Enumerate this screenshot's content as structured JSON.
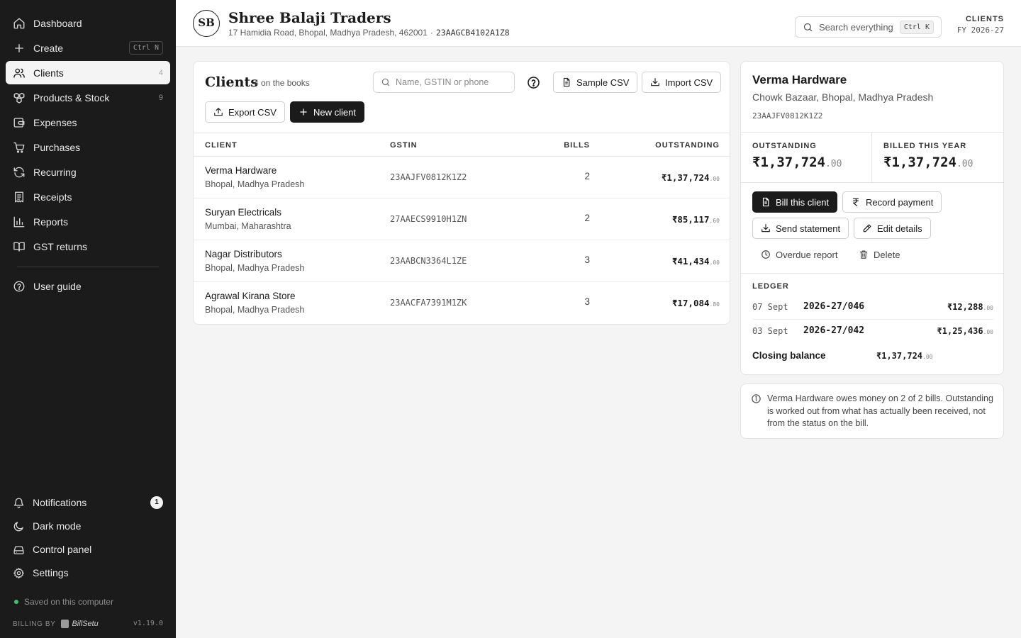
{
  "sidebar": {
    "nav": [
      {
        "label": "Dashboard",
        "icon": "home-icon"
      },
      {
        "label": "Create",
        "icon": "plus-icon",
        "shortcut": "Ctrl N"
      },
      {
        "label": "Clients",
        "icon": "users-icon",
        "count": "4",
        "active": true
      },
      {
        "label": "Products & Stock",
        "icon": "boxes-icon",
        "count": "9"
      },
      {
        "label": "Expenses",
        "icon": "wallet-icon"
      },
      {
        "label": "Purchases",
        "icon": "cart-icon"
      },
      {
        "label": "Recurring",
        "icon": "refresh-icon"
      },
      {
        "label": "Receipts",
        "icon": "receipt-icon"
      },
      {
        "label": "Reports",
        "icon": "bar-chart-icon"
      },
      {
        "label": "GST returns",
        "icon": "book-icon"
      }
    ],
    "user_guide": "User guide",
    "bottom": [
      {
        "label": "Notifications",
        "icon": "bell-icon",
        "badge": "1"
      },
      {
        "label": "Dark mode",
        "icon": "moon-icon"
      },
      {
        "label": "Control panel",
        "icon": "drive-icon"
      },
      {
        "label": "Settings",
        "icon": "gear-icon"
      }
    ],
    "saved_status": "Saved on this computer",
    "billing_by": "BILLING BY",
    "brand": "BillSetu",
    "version": "v1.19.0"
  },
  "header": {
    "avatar_initials": "SB",
    "business_name": "Shree Balaji Traders",
    "address": "17 Hamidia Road, Bhopal, Madhya Pradesh, 462001",
    "separator": "·",
    "gstin": "23AAGCB4102A1Z8",
    "search_placeholder": "Search everything",
    "search_shortcut": "Ctrl K",
    "section": "CLIENTS",
    "fiscal_year": "FY 2026-27"
  },
  "clients": {
    "title": "Clients",
    "count_text": "4 on the books",
    "search_placeholder": "Name, GSTIN or phone",
    "sample_csv": "Sample CSV",
    "import_csv": "Import CSV",
    "export_csv": "Export CSV",
    "new_client": "New client",
    "columns": [
      "CLIENT",
      "GSTIN",
      "BILLS",
      "OUTSTANDING"
    ],
    "rows": [
      {
        "name": "Verma Hardware",
        "location": "Bhopal, Madhya Pradesh",
        "gstin": "23AAJFV0812K1Z2",
        "bills": "2",
        "amount": "₹1,37,724",
        "paise": ".00"
      },
      {
        "name": "Suryan Electricals",
        "location": "Mumbai, Maharashtra",
        "gstin": "27AAECS9910H1ZN",
        "bills": "2",
        "amount": "₹85,117",
        "paise": ".60"
      },
      {
        "name": "Nagar Distributors",
        "location": "Bhopal, Madhya Pradesh",
        "gstin": "23AABCN3364L1ZE",
        "bills": "3",
        "amount": "₹41,434",
        "paise": ".00"
      },
      {
        "name": "Agrawal Kirana Store",
        "location": "Bhopal, Madhya Pradesh",
        "gstin": "23AACFA7391M1ZK",
        "bills": "3",
        "amount": "₹17,084",
        "paise": ".80"
      }
    ]
  },
  "detail": {
    "name": "Verma Hardware",
    "address": "Chowk Bazaar, Bhopal, Madhya Pradesh",
    "gstin": "23AAJFV0812K1Z2",
    "outstanding_label": "OUTSTANDING",
    "outstanding_amount": "₹1,37,724",
    "outstanding_paise": ".00",
    "billed_label": "BILLED THIS YEAR",
    "billed_amount": "₹1,37,724",
    "billed_paise": ".00",
    "actions": {
      "bill": "Bill this client",
      "record_payment": "Record payment",
      "send_statement": "Send statement",
      "edit_details": "Edit details",
      "overdue_report": "Overdue report",
      "delete": "Delete"
    },
    "ledger_title": "LEDGER",
    "ledger": [
      {
        "date": "07 Sept",
        "invoice": "2026-27/046",
        "amount": "₹12,288",
        "paise": ".00"
      },
      {
        "date": "03 Sept",
        "invoice": "2026-27/042",
        "amount": "₹1,25,436",
        "paise": ".00"
      }
    ],
    "closing_label": "Closing balance",
    "closing_amount": "₹1,37,724",
    "closing_paise": ".00"
  },
  "info_note": "Verma Hardware owes money on 2 of 2 bills. Outstanding is worked out from what has actually been received, not from the status on the bill."
}
